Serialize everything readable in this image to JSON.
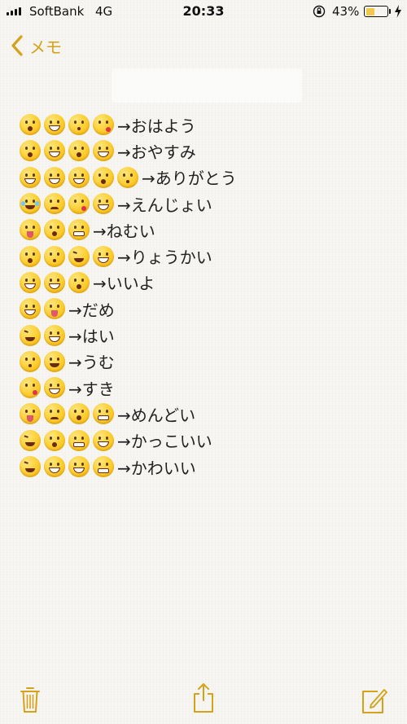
{
  "status_bar": {
    "carrier": "SoftBank",
    "network": "4G",
    "time": "20:33",
    "battery_percent": "43%",
    "battery_level": 0.43,
    "icons": [
      "signal-icon",
      "orientation-lock-icon",
      "battery-icon",
      "charging-bolt-icon"
    ]
  },
  "nav": {
    "back_label": "メモ",
    "back_icon": "chevron-left-icon",
    "accent_color": "#d6a21a"
  },
  "note": {
    "lines": [
      {
        "emojis": [
          "o",
          "grin",
          "kiss",
          "kissheart"
        ],
        "text": "→おはよう"
      },
      {
        "emojis": [
          "o",
          "grin",
          "o",
          "grin"
        ],
        "text": "→おやすみ"
      },
      {
        "emojis": [
          "grin",
          "grin",
          "grin",
          "o",
          "kiss"
        ],
        "text": "→ありがとう"
      },
      {
        "emojis": [
          "cry",
          "sad",
          "kissheart",
          "grin"
        ],
        "text": "→えんじょい"
      },
      {
        "emojis": [
          "tongue",
          "o",
          "grim"
        ],
        "text": "→ねむい"
      },
      {
        "emojis": [
          "o",
          "kiss",
          "xd",
          "grin"
        ],
        "text": "→りょうかい"
      },
      {
        "emojis": [
          "grin",
          "grin",
          "o"
        ],
        "text": "→いいよ"
      },
      {
        "emojis": [
          "grin",
          "tongue"
        ],
        "text": "→だめ"
      },
      {
        "emojis": [
          "xd",
          "grin"
        ],
        "text": "→はい"
      },
      {
        "emojis": [
          "kiss",
          "steam"
        ],
        "text": "→うむ"
      },
      {
        "emojis": [
          "kissheart",
          "grin"
        ],
        "text": "→すき"
      },
      {
        "emojis": [
          "tongue",
          "sad",
          "o",
          "grim"
        ],
        "text": "→めんどい"
      },
      {
        "emojis": [
          "xd",
          "o",
          "grim",
          "grin"
        ],
        "text": "→かっこいい"
      },
      {
        "emojis": [
          "xd",
          "grin",
          "grin",
          "grim"
        ],
        "text": "→かわいい"
      }
    ]
  },
  "toolbar": {
    "icons": [
      "trash-icon",
      "share-icon",
      "compose-icon"
    ]
  }
}
